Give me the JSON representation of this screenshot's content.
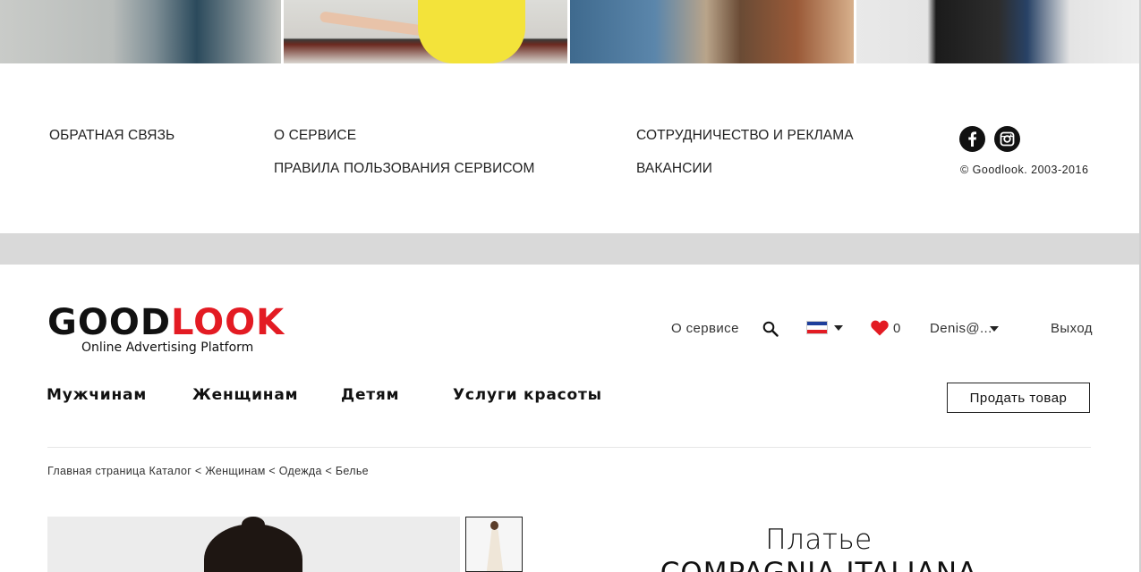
{
  "footer": {
    "links": [
      {
        "label": "ОБРАТНАЯ СВЯЗЬ"
      },
      {
        "label": "О СЕРВИСЕ"
      },
      {
        "label": "ПРАВИЛА ПОЛЬЗОВАНИЯ СЕРВИСОМ"
      },
      {
        "label": "СОТРУДНИЧЕСТВО И РЕКЛАМА"
      },
      {
        "label": "ВАКАНСИИ"
      }
    ],
    "social": [
      "facebook-icon",
      "instagram-icon"
    ],
    "copyright": "© Goodlook. 2003-2016"
  },
  "header": {
    "logo": {
      "part1": "GOOD",
      "part2": "LOOK",
      "tagline": "Online Advertising Platform",
      "accent_color": "#e31b23"
    },
    "about_link": "О сервисе",
    "search_icon": "search-icon",
    "language_flag": "french-flag",
    "favorites_count": "0",
    "user": "Denis@...",
    "logout": "Выход"
  },
  "nav": {
    "items": [
      "Мужчинам",
      "Женщинам",
      "Детям",
      "Услуги красоты"
    ],
    "sell_button": "Продать товар"
  },
  "breadcrumb": {
    "items": [
      "Главная страница",
      "Каталог",
      "Женщинам",
      "Одежда",
      "Белье"
    ],
    "separator": "<"
  },
  "product": {
    "title": "Платье",
    "brand": "COMPAGNIA ITALIANA"
  }
}
